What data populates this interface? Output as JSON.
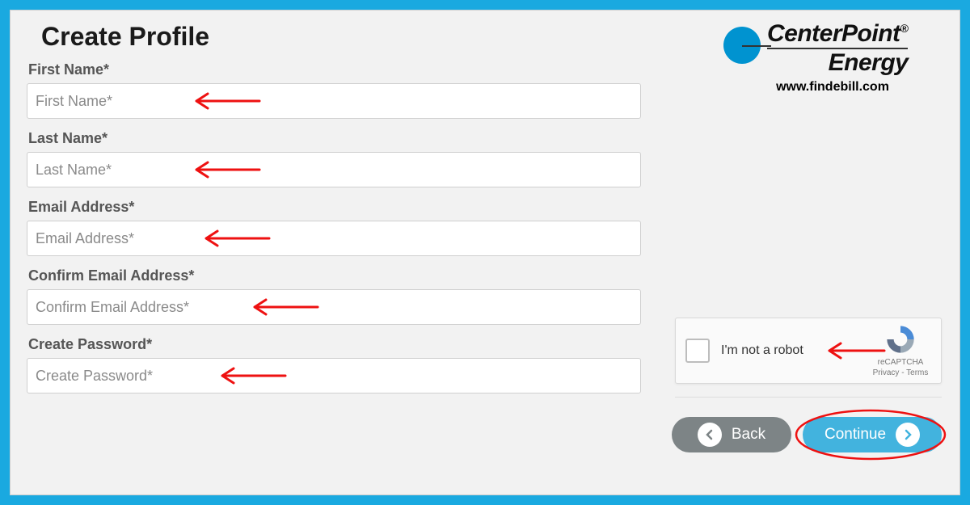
{
  "page": {
    "title": "Create Profile"
  },
  "brand": {
    "line1": "CenterPoint",
    "line2": "Energy",
    "reg": "®",
    "url": "www.findebill.com"
  },
  "fields": {
    "first_name": {
      "label": "First Name*",
      "placeholder": "First Name*",
      "value": ""
    },
    "last_name": {
      "label": "Last Name*",
      "placeholder": "Last Name*",
      "value": ""
    },
    "email": {
      "label": "Email Address*",
      "placeholder": "Email Address*",
      "value": ""
    },
    "confirm_email": {
      "label": "Confirm Email Address*",
      "placeholder": "Confirm Email Address*",
      "value": ""
    },
    "password": {
      "label": "Create Password*",
      "placeholder": "Create Password*",
      "value": ""
    }
  },
  "recaptcha": {
    "label": "I'm not a robot",
    "brand": "reCAPTCHA",
    "privacy": "Privacy",
    "terms": "Terms",
    "sep": " - "
  },
  "buttons": {
    "back": "Back",
    "continue": "Continue"
  }
}
